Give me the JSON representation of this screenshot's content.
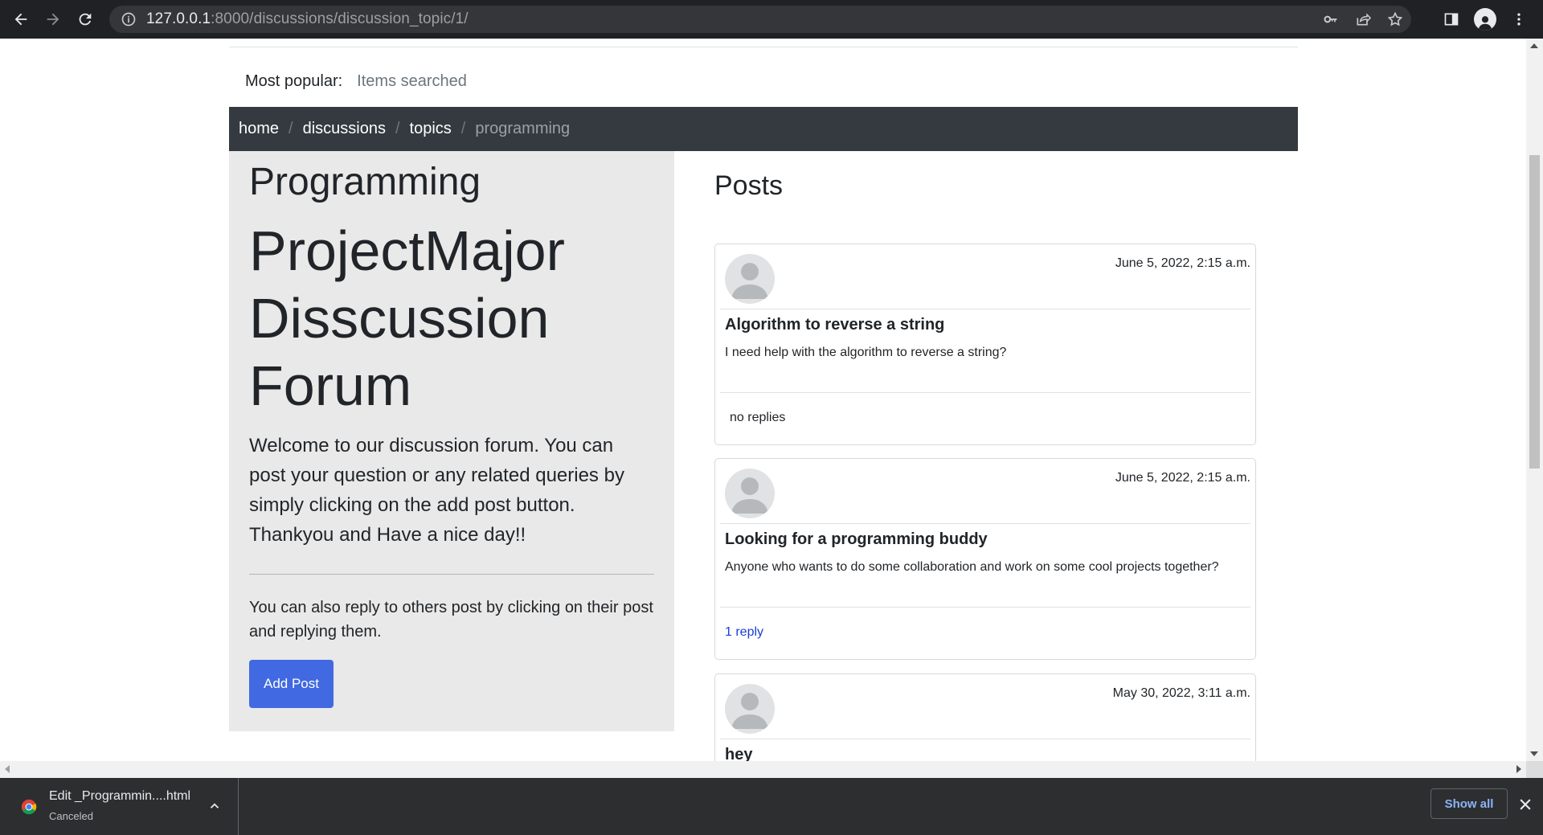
{
  "browser": {
    "url_host": "127.0.0.1",
    "url_rest": ":8000/discussions/discussion_topic/1/"
  },
  "popular": {
    "label": "Most popular:",
    "item": "Items searched"
  },
  "breadcrumb": {
    "home": "home",
    "discussions": "discussions",
    "topics": "topics",
    "current": "programming",
    "separator": "/"
  },
  "sidebar": {
    "topic_title": "Programming",
    "forum_title": "ProjectMajor Disscussion Forum",
    "lead": "Welcome to our discussion forum. You can post your question or any related queries by simply clicking on the add post button. Thankyou and Have a nice day!!",
    "note": "You can also reply to others post by clicking on their post and replying them.",
    "add_post_label": "Add Post",
    "button_color": "#4169e1"
  },
  "posts": {
    "heading": "Posts",
    "items": [
      {
        "date": "June 5, 2022, 2:15 a.m.",
        "title": "Algorithm to reverse a string",
        "body": "I need help with the algorithm to reverse a string?",
        "replies": "no replies"
      },
      {
        "date": "June 5, 2022, 2:15 a.m.",
        "title": "Looking for a programming buddy",
        "body": "Anyone who wants to do some collaboration and work on some cool projects together?",
        "replies": "1 reply"
      },
      {
        "date": "May 30, 2022, 3:11 a.m.",
        "title": "hey",
        "body": "",
        "replies": ""
      }
    ]
  },
  "downloads": {
    "file_name": "Edit _Programmin....html",
    "status": "Canceled",
    "show_all_label": "Show all"
  },
  "icons": {
    "back": "arrow-left-icon",
    "forward": "arrow-right-icon",
    "reload": "reload-icon",
    "info": "info-icon",
    "key": "key-icon",
    "share": "share-icon",
    "star": "star-icon",
    "sidepanel": "side-panel-icon",
    "profile": "profile-icon",
    "menu": "kebab-menu-icon",
    "chrome": "chrome-logo-icon",
    "close": "close-icon"
  }
}
